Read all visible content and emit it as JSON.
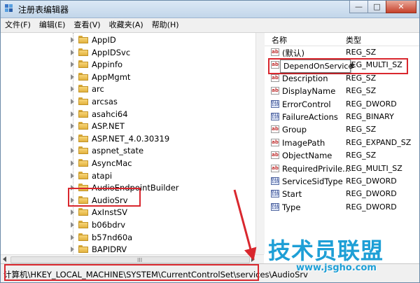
{
  "window": {
    "title": "注册表编辑器"
  },
  "titlebar_buttons": {
    "minimize": "—",
    "maximize": "□",
    "close": "✕"
  },
  "menu": [
    "文件(F)",
    "编辑(E)",
    "查看(V)",
    "收藏夹(A)",
    "帮助(H)"
  ],
  "tree": {
    "items": [
      {
        "label": "AppID"
      },
      {
        "label": "AppIDSvc"
      },
      {
        "label": "Appinfo"
      },
      {
        "label": "AppMgmt"
      },
      {
        "label": "arc"
      },
      {
        "label": "arcsas"
      },
      {
        "label": "asahci64"
      },
      {
        "label": "ASP.NET"
      },
      {
        "label": "ASP.NET_4.0.30319"
      },
      {
        "label": "aspnet_state"
      },
      {
        "label": "AsyncMac"
      },
      {
        "label": "atapi"
      },
      {
        "label": "AudioEndpointBuilder"
      },
      {
        "label": "AudioSrv",
        "selected": true
      },
      {
        "label": "AxInstSV"
      },
      {
        "label": "b06bdrv"
      },
      {
        "label": "b57nd60a"
      },
      {
        "label": "BAPIDRV"
      }
    ],
    "hscroll_grip": "III"
  },
  "values_pane": {
    "columns": {
      "name": "名称",
      "type": "类型"
    },
    "rows": [
      {
        "name": "(默认)",
        "type": "REG_SZ",
        "icon": "string-value-icon"
      },
      {
        "name": "DependOnService",
        "type": "REG_MULTI_SZ",
        "icon": "string-value-icon"
      },
      {
        "name": "Description",
        "type": "REG_SZ",
        "icon": "string-value-icon"
      },
      {
        "name": "DisplayName",
        "type": "REG_SZ",
        "icon": "string-value-icon"
      },
      {
        "name": "ErrorControl",
        "type": "REG_DWORD",
        "icon": "binary-value-icon"
      },
      {
        "name": "FailureActions",
        "type": "REG_BINARY",
        "icon": "binary-value-icon"
      },
      {
        "name": "Group",
        "type": "REG_SZ",
        "icon": "string-value-icon"
      },
      {
        "name": "ImagePath",
        "type": "REG_EXPAND_SZ",
        "icon": "string-value-icon"
      },
      {
        "name": "ObjectName",
        "type": "REG_SZ",
        "icon": "string-value-icon"
      },
      {
        "name": "RequiredPrivile...",
        "type": "REG_MULTI_SZ",
        "icon": "string-value-icon"
      },
      {
        "name": "ServiceSidType",
        "type": "REG_DWORD",
        "icon": "binary-value-icon"
      },
      {
        "name": "Start",
        "type": "REG_DWORD",
        "icon": "binary-value-icon"
      },
      {
        "name": "Type",
        "type": "REG_DWORD",
        "icon": "binary-value-icon"
      }
    ],
    "tooltip": "DependOnService"
  },
  "statusbar": {
    "path": "计算机\\HKEY_LOCAL_MACHINE\\SYSTEM\\CurrentControlSet\\services\\AudioSrv"
  },
  "watermark": {
    "title": "技术员联盟",
    "url": "www.jsgho.com"
  },
  "colors": {
    "highlight": "#d9272e",
    "watermark": "#1e9fd6"
  }
}
